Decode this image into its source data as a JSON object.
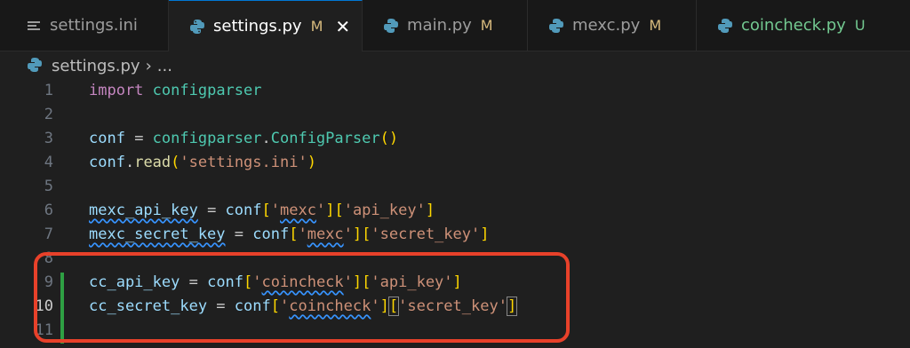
{
  "tabs": [
    {
      "label": "settings.ini",
      "icon": "settings-file-icon",
      "status": ""
    },
    {
      "label": "settings.py",
      "icon": "python-icon",
      "status": "M",
      "active": true
    },
    {
      "label": "main.py",
      "icon": "python-icon",
      "status": "M"
    },
    {
      "label": "mexc.py",
      "icon": "python-icon",
      "status": "M"
    },
    {
      "label": "coincheck.py",
      "icon": "python-icon",
      "status": "U"
    }
  ],
  "close_glyph": "✕",
  "breadcrumb": {
    "file": "settings.py",
    "separator": "›",
    "more": "..."
  },
  "lines": [
    {
      "n": "1",
      "tokens": [
        [
          "import",
          "kw"
        ],
        [
          " ",
          ""
        ],
        [
          "configparser",
          "mod-n"
        ]
      ]
    },
    {
      "n": "2",
      "tokens": []
    },
    {
      "n": "3",
      "tokens": [
        [
          "conf",
          "var"
        ],
        [
          " = ",
          "op"
        ],
        [
          "configparser",
          "mod-n"
        ],
        [
          ".",
          "op"
        ],
        [
          "ConfigParser",
          "mod-n"
        ],
        [
          "()",
          "br1"
        ]
      ]
    },
    {
      "n": "4",
      "tokens": [
        [
          "conf",
          "var"
        ],
        [
          ".",
          "op"
        ],
        [
          "read",
          "fn"
        ],
        [
          "(",
          "br1"
        ],
        [
          "'settings.ini'",
          "str"
        ],
        [
          ")",
          "br1"
        ]
      ]
    },
    {
      "n": "5",
      "tokens": []
    },
    {
      "n": "6",
      "tokens": [
        [
          "mexc_api_key",
          "var sq"
        ],
        [
          " = ",
          "op"
        ],
        [
          "conf",
          "var"
        ],
        [
          "[",
          "br1"
        ],
        [
          "'",
          "str"
        ],
        [
          "mexc",
          "str sq"
        ],
        [
          "'",
          "str"
        ],
        [
          "]",
          "br1"
        ],
        [
          "[",
          "br1"
        ],
        [
          "'api_key'",
          "str"
        ],
        [
          "]",
          "br1"
        ]
      ]
    },
    {
      "n": "7",
      "tokens": [
        [
          "mexc_secret_key",
          "var sq"
        ],
        [
          " = ",
          "op"
        ],
        [
          "conf",
          "var"
        ],
        [
          "[",
          "br1"
        ],
        [
          "'",
          "str"
        ],
        [
          "mexc",
          "str sq"
        ],
        [
          "'",
          "str"
        ],
        [
          "]",
          "br1"
        ],
        [
          "[",
          "br1"
        ],
        [
          "'secret_key'",
          "str"
        ],
        [
          "]",
          "br1"
        ]
      ]
    },
    {
      "n": "8",
      "tokens": []
    },
    {
      "n": "9",
      "tokens": [
        [
          "cc_api_key",
          "var"
        ],
        [
          " = ",
          "op"
        ],
        [
          "conf",
          "var"
        ],
        [
          "[",
          "br1"
        ],
        [
          "'",
          "str"
        ],
        [
          "coincheck",
          "str sq"
        ],
        [
          "'",
          "str"
        ],
        [
          "]",
          "br1"
        ],
        [
          "[",
          "br1"
        ],
        [
          "'api_key'",
          "str"
        ],
        [
          "]",
          "br1"
        ]
      ]
    },
    {
      "n": "10",
      "current": true,
      "tokens": [
        [
          "cc_secret_key",
          "var"
        ],
        [
          " = ",
          "op"
        ],
        [
          "conf",
          "var"
        ],
        [
          "[",
          "br1"
        ],
        [
          "'",
          "str"
        ],
        [
          "coincheck",
          "str sq"
        ],
        [
          "'",
          "str"
        ],
        [
          "]",
          "br1"
        ],
        [
          "[",
          "br1 cursor-box"
        ],
        [
          "'secret_key'",
          "str"
        ],
        [
          "]",
          "br1 cursor-box"
        ]
      ]
    },
    {
      "n": "11",
      "tokens": []
    }
  ],
  "colors": {
    "accent": "#0078d4",
    "highlight": "#e8412a",
    "added": "#2ea043"
  }
}
